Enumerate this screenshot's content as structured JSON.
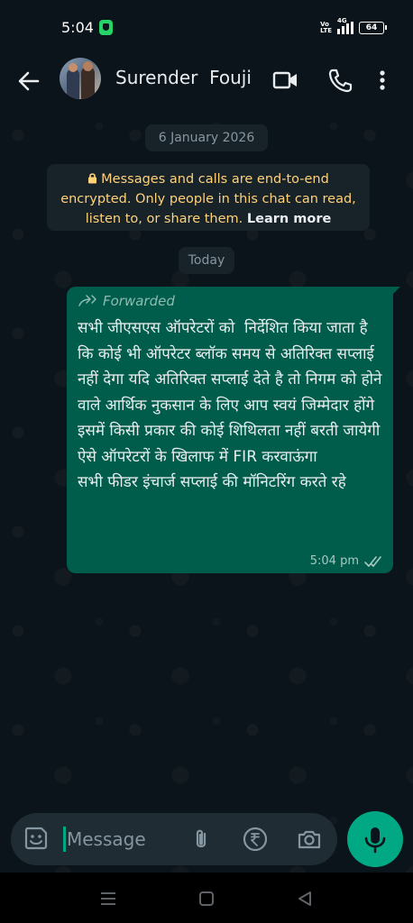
{
  "status_bar": {
    "time": "5:04",
    "network_label": "4G",
    "volte_top": "Vo",
    "volte_bottom": "LTE",
    "battery": "64"
  },
  "header": {
    "contact_name": "Surender  Fouji",
    "icons": [
      "back-arrow-icon",
      "video-call-icon",
      "phone-icon",
      "more-vert-icon"
    ]
  },
  "chat": {
    "date_chip": "6 January 2026",
    "encryption_notice": {
      "text": "Messages and calls are end-to-end encrypted. Only people in this chat can read, listen to, or share them.",
      "link": "Learn more",
      "color": "#ffd279"
    },
    "today_chip": "Today",
    "messages": [
      {
        "direction": "outgoing",
        "forwarded_label": "Forwarded",
        "text": "सभी जीएसएस ऑपरेटरों को  निर्देशित किया जाता है कि कोई भी ऑपरेटर ब्लॉक समय से अतिरिक्त सप्लाई नहीं देगा यदि अतिरिक्त सप्लाई देते है तो निगम को होने वाले आर्थिक नुकसान के लिए आप स्वयं जिम्मेदार होंगे इसमें किसी प्रकार की कोई शिथिलता नहीं बरती जायेगी ऐसे ऑपरेटरों के खिलाफ में FIR करवाऊंगा\nसभी फीडर इंचार्ज सप्लाई की मॉनिटरिंग करते रहे",
        "time": "5:04 pm",
        "status": "read",
        "bubble_color": "#005c4b"
      }
    ]
  },
  "input_bar": {
    "placeholder": "Message",
    "icons": [
      "emoji-icon",
      "attach-icon",
      "rupee-payment-icon",
      "camera-icon",
      "mic-icon"
    ]
  },
  "colors": {
    "background": "#0b141a",
    "accent": "#00a884",
    "chip": "#182229"
  }
}
